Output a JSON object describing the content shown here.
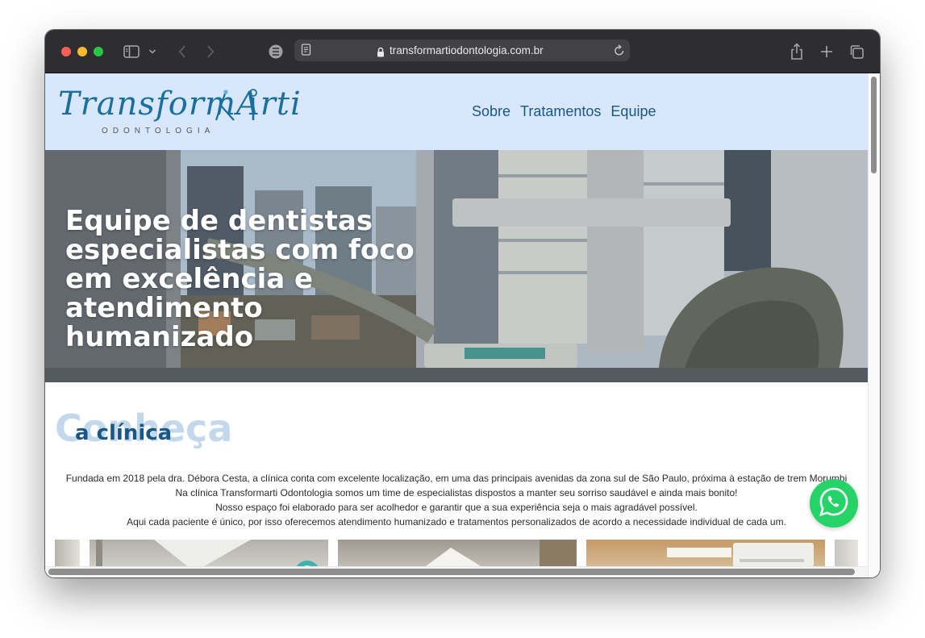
{
  "browser": {
    "url": "transformartiodontologia.com.br",
    "icons": [
      "sidebar-icon",
      "chevron-down-icon",
      "back-icon",
      "forward-icon",
      "privacy-icon",
      "reader-icon",
      "lock-icon",
      "reload-icon",
      "share-icon",
      "plus-icon",
      "tabs-icon"
    ]
  },
  "site": {
    "logo": {
      "word": "TransformArti",
      "sub": "ODONTOLOGIA"
    },
    "nav": [
      "Sobre",
      "Tratamentos",
      "Equipe"
    ],
    "hero": {
      "title": "Equipe de dentistas especialistas com foco em excelência e atendimento humanizado"
    },
    "about": {
      "ghost": "Conheça",
      "title": "a clínica",
      "paragraphs": [
        "Fundada em 2018 pela dra. Débora Cesta, a clínica conta com excelente localização, em uma das principais avenidas da zona sul de São Paulo, próxima à estação de trem Morumbi",
        "Na clínica Transformarti Odontologia somos um time de especialistas dispostos a manter seu sorriso saudável e ainda mais bonito!",
        "Nosso espaço foi elaborado para ser acolhedor e garantir que a sua experiência seja o mais agradável possível.",
        "Aqui cada paciente é único, por isso oferecemos atendimento humanizado e tratamentos personalizados de acordo a necessidade individual de cada um."
      ]
    },
    "whatsapp_icon": "whatsapp-icon"
  },
  "colors": {
    "header_bg": "#d8e7fb",
    "brand_blue": "#1a5784",
    "ghost_text": "#c3d8ea",
    "whatsapp": "#25d366",
    "toolbar": "#2e2e30"
  }
}
